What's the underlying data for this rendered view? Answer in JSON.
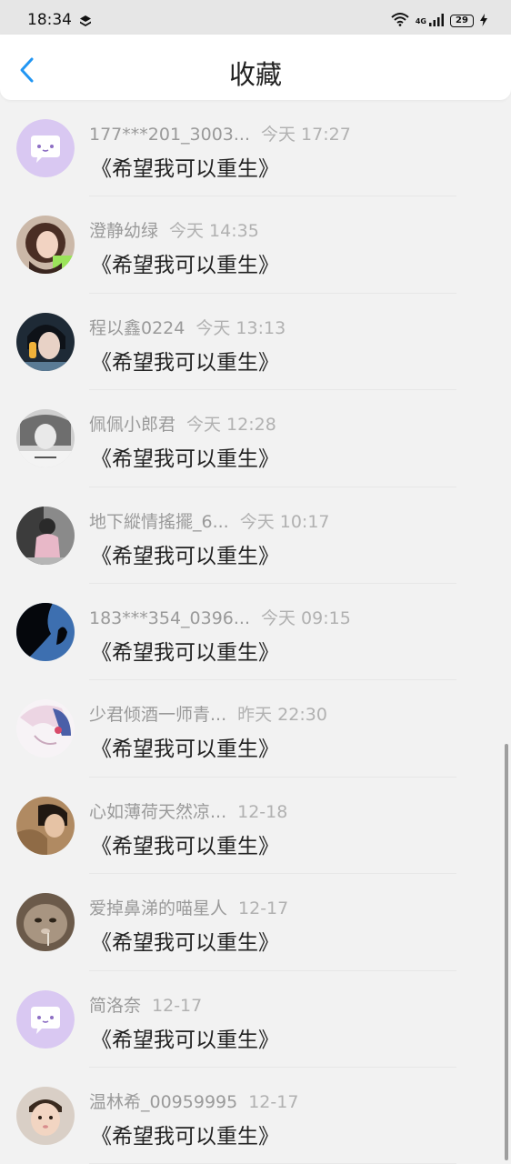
{
  "status_bar": {
    "time": "18:34",
    "network": "4G",
    "battery": "29"
  },
  "header": {
    "title": "收藏"
  },
  "items": [
    {
      "user": "177***201_3003...",
      "time": "今天 17:27",
      "title": "《希望我可以重生》",
      "avatar": "chat-bubble-avatar"
    },
    {
      "user": "澄静幼绿",
      "time": "今天 14:35",
      "title": "《希望我可以重生》",
      "avatar": "girl-photo-avatar"
    },
    {
      "user": "程以鑫0224",
      "time": "今天 13:13",
      "title": "《希望我可以重生》",
      "avatar": "portrait-avatar"
    },
    {
      "user": "佩佩小郎君",
      "time": "今天 12:28",
      "title": "《希望我可以重生》",
      "avatar": "grayscale-avatar"
    },
    {
      "user": "地下縱情搖擺_6...",
      "time": "今天 10:17",
      "title": "《希望我可以重生》",
      "avatar": "child-photo-avatar"
    },
    {
      "user": "183***354_0396...",
      "time": "今天 09:15",
      "title": "《希望我可以重生》",
      "avatar": "silhouette-avatar"
    },
    {
      "user": "少君倾酒一师青...",
      "time": "昨天 22:30",
      "title": "《希望我可以重生》",
      "avatar": "anime-avatar"
    },
    {
      "user": "心如薄荷天然凉...",
      "time": "12-18",
      "title": "《希望我可以重生》",
      "avatar": "boy-photo-avatar"
    },
    {
      "user": "爱掉鼻涕的喵星人",
      "time": "12-17",
      "title": "《希望我可以重生》",
      "avatar": "cat-avatar"
    },
    {
      "user": "简洛奈",
      "time": "12-17",
      "title": "《希望我可以重生》",
      "avatar": "chat-bubble-avatar"
    },
    {
      "user": "温林希_00959995",
      "time": "12-17",
      "title": "《希望我可以重生》",
      "avatar": "baby-photo-avatar"
    }
  ],
  "colors": {
    "accent": "#2196F3",
    "bubble_avatar": "#D9C8F2"
  }
}
